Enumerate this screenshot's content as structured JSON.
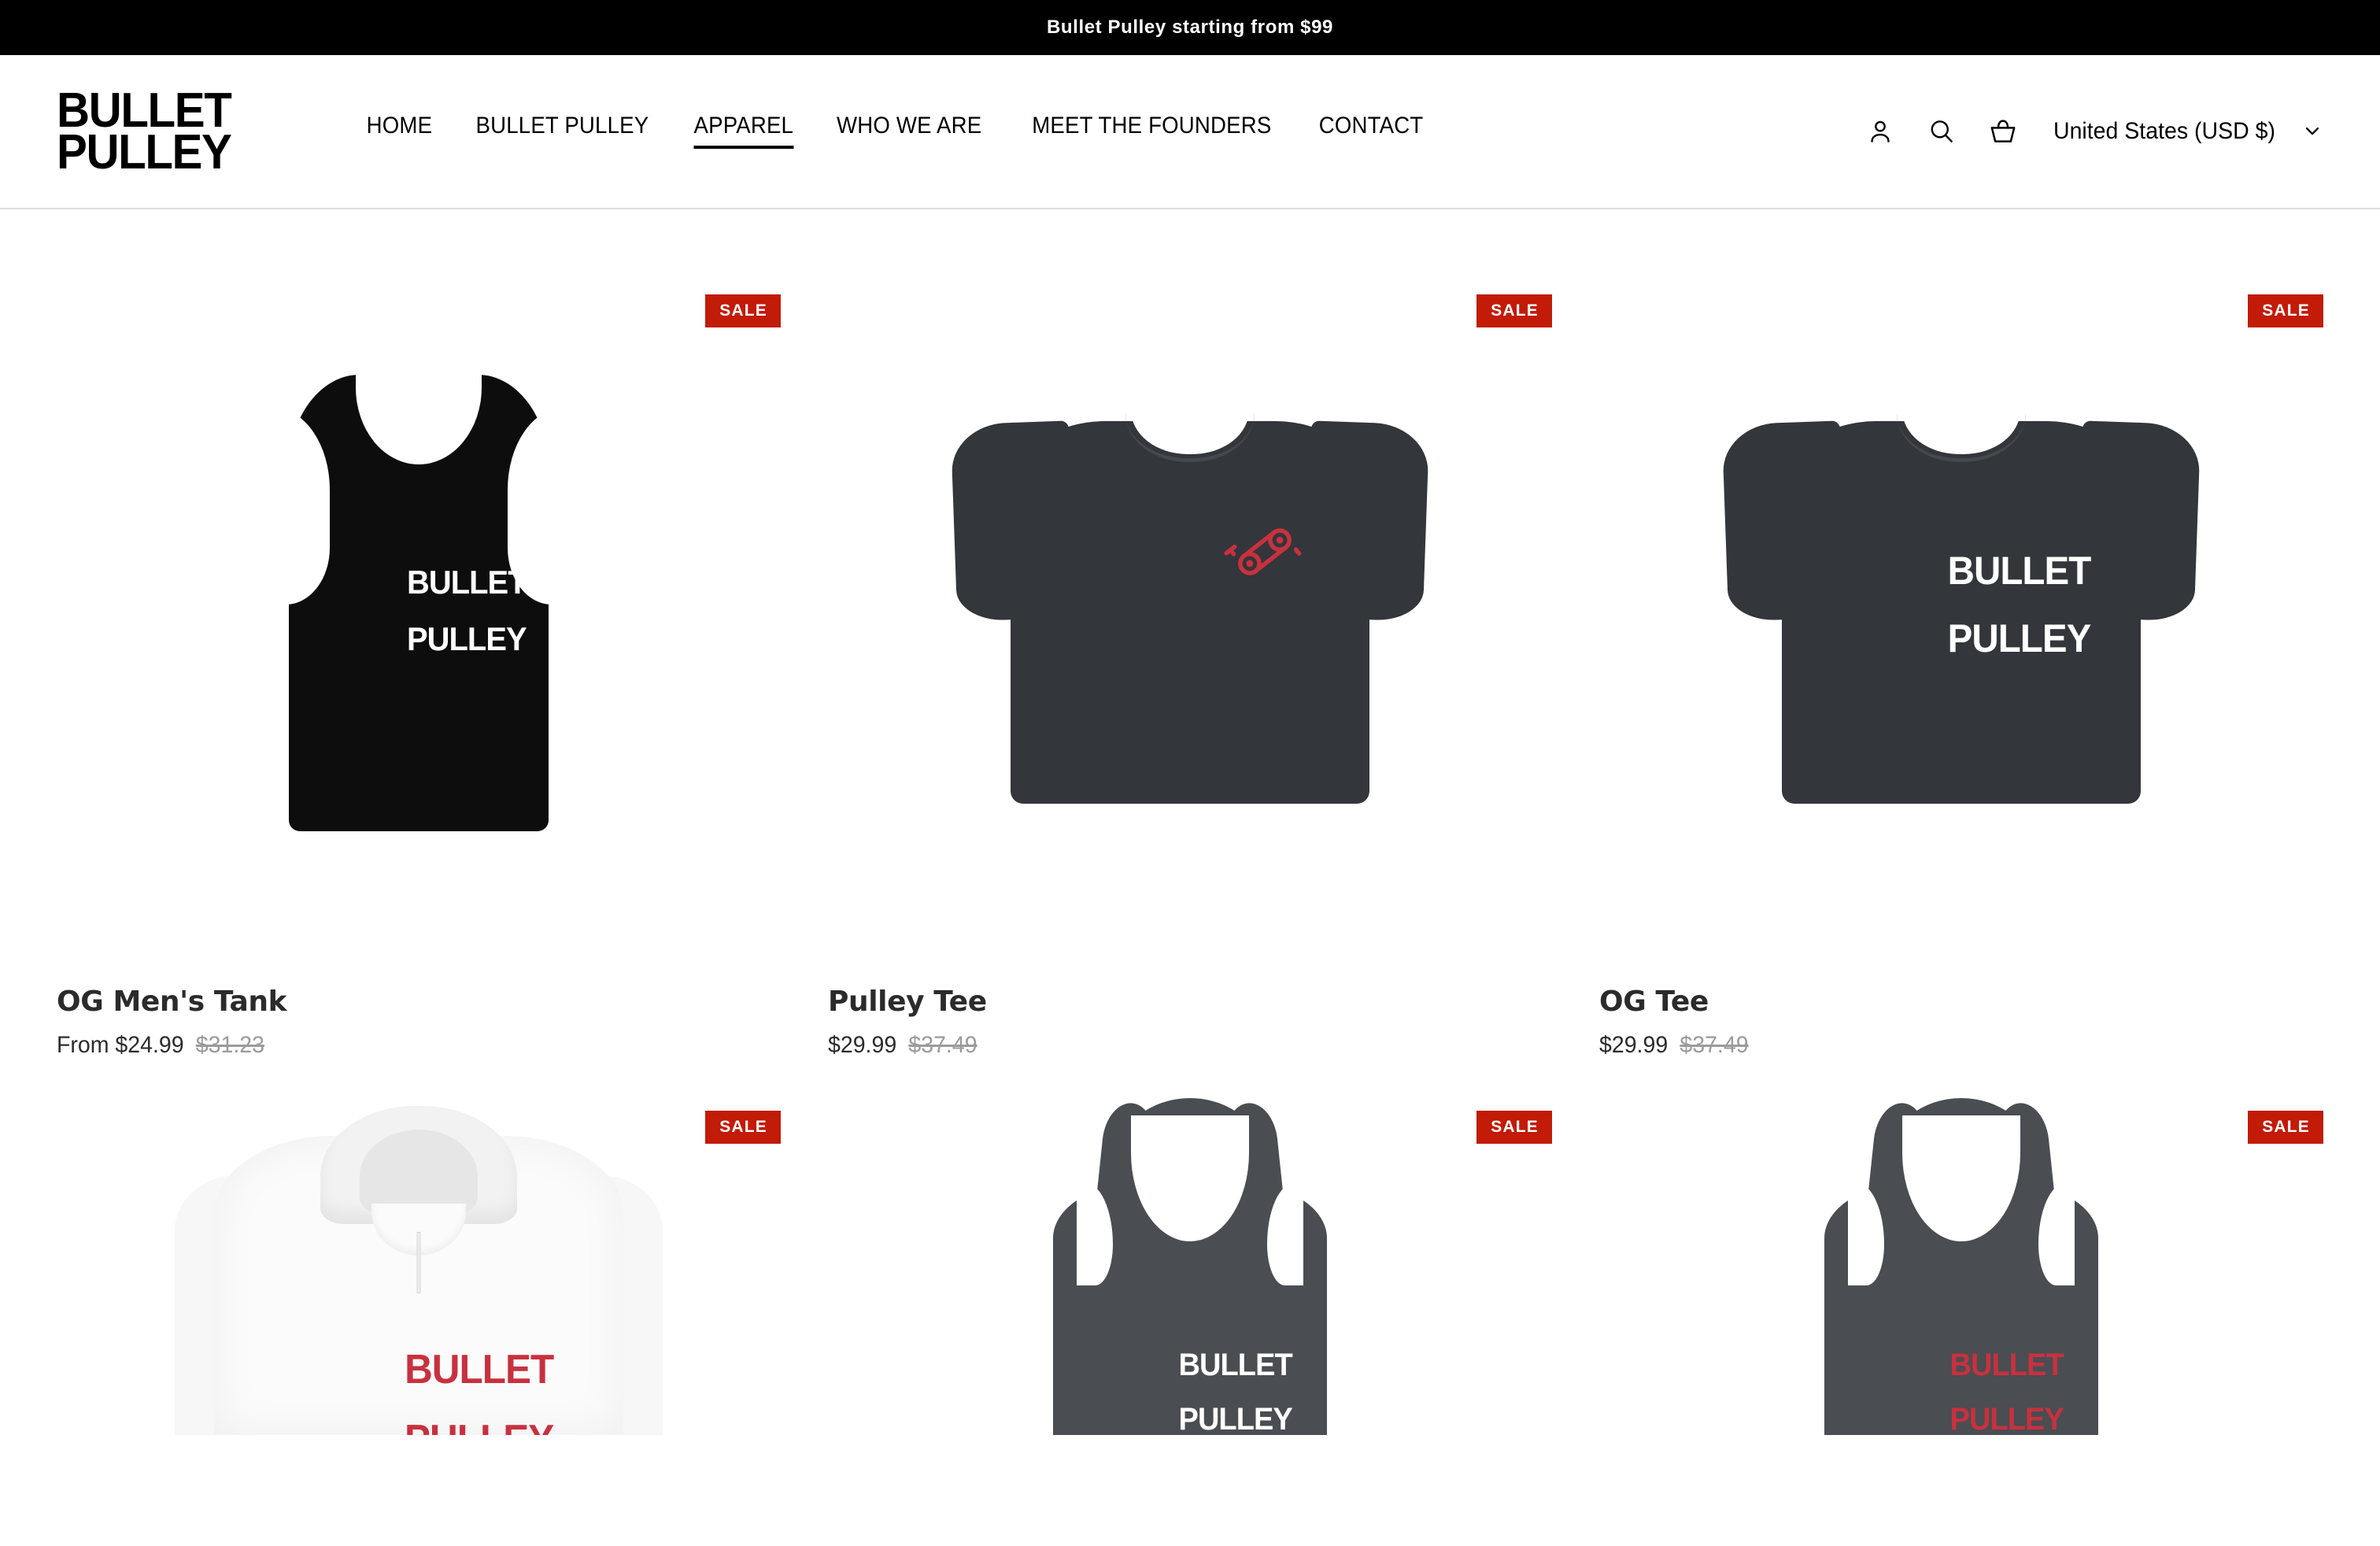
{
  "announcement": {
    "text": "Bullet Pulley starting from $99"
  },
  "header": {
    "logo_line1": "BULLET",
    "logo_line2": "PULLEY",
    "nav": [
      {
        "label": "HOME",
        "active": false
      },
      {
        "label": "BULLET PULLEY",
        "active": false
      },
      {
        "label": "APPAREL",
        "active": true
      },
      {
        "label": "WHO WE ARE",
        "active": false
      },
      {
        "label": "MEET THE FOUNDERS",
        "active": false
      },
      {
        "label": "CONTACT",
        "active": false
      }
    ],
    "icons": {
      "account": "account-icon",
      "search": "search-icon",
      "cart": "cart-icon",
      "chevron": "chevron-down-icon"
    },
    "locale": {
      "label": "United States (USD  $)"
    }
  },
  "colors": {
    "sale_badge_bg": "#c21b07",
    "brand_red": "#c8313f",
    "heather_grey": "#33363a",
    "tank_black": "#0d0d0d",
    "compare_price": "#9b9b9b",
    "text": "#2b2b2b"
  },
  "products": [
    {
      "title": "OG Men's Tank",
      "price": "From $24.99",
      "compare_at": "$31.23",
      "badge": "SALE",
      "garment": "tank-black",
      "print_text_line1": "BULLET",
      "print_text_line2": "PULLEY",
      "print_color": "#ffffff"
    },
    {
      "title": "Pulley Tee",
      "price": "$29.99",
      "compare_at": "$37.49",
      "badge": "SALE",
      "garment": "tee-grey-pulley-icon",
      "print_text_line1": "",
      "print_text_line2": "",
      "print_color": "#c8313f"
    },
    {
      "title": "OG Tee",
      "price": "$29.99",
      "compare_at": "$37.49",
      "badge": "SALE",
      "garment": "tee-grey",
      "print_text_line1": "BULLET",
      "print_text_line2": "PULLEY",
      "print_color": "#ffffff"
    },
    {
      "title": "",
      "price": "",
      "compare_at": "",
      "badge": "SALE",
      "garment": "hoodie-white",
      "print_text_line1": "BULLET",
      "print_text_line2": "PULLEY",
      "print_color": "#c8313f"
    },
    {
      "title": "",
      "price": "",
      "compare_at": "",
      "badge": "SALE",
      "garment": "racerback-grey",
      "print_text_line1": "BULLET",
      "print_text_line2": "PULLEY",
      "print_color": "#ffffff"
    },
    {
      "title": "",
      "price": "",
      "compare_at": "",
      "badge": "SALE",
      "garment": "racerback-grey",
      "print_text_line1": "BULLET",
      "print_text_line2": "PULLEY",
      "print_color": "#c8313f"
    }
  ]
}
